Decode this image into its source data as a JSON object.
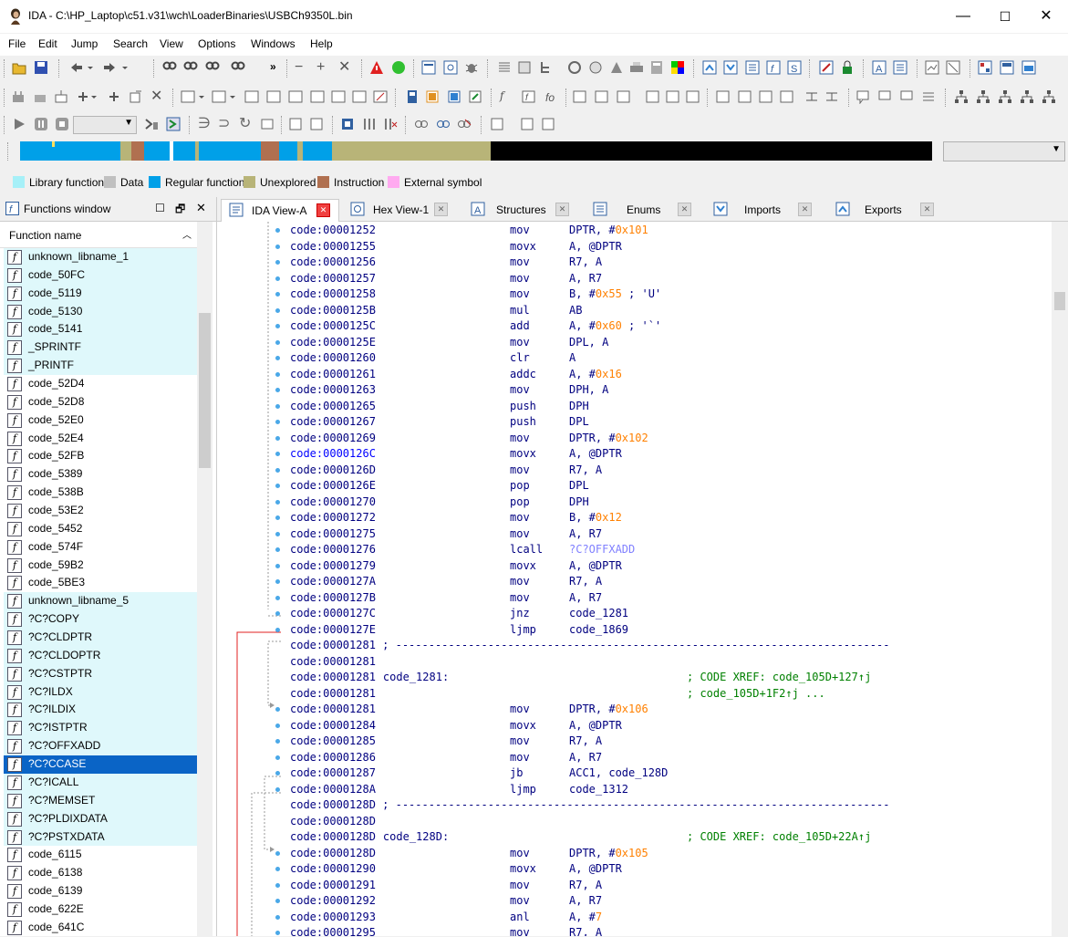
{
  "window": {
    "title": "IDA - C:\\HP_Laptop\\c51.v31\\wch\\LoaderBinaries\\USBCh9350L.bin",
    "min": "—",
    "max": "☐",
    "close": "✕"
  },
  "menu": [
    "File",
    "Edit",
    "Jump",
    "Search",
    "View",
    "Options",
    "Windows",
    "Help"
  ],
  "legend": [
    {
      "label": "Library function",
      "color": "#a6f0f8"
    },
    {
      "label": "Data",
      "color": "#c0c0c0"
    },
    {
      "label": "Regular function",
      "color": "#00a0e8"
    },
    {
      "label": "Unexplored",
      "color": "#b8b478"
    },
    {
      "label": "Instruction",
      "color": "#b07050"
    },
    {
      "label": "External symbol",
      "color": "#ffaaf0"
    }
  ],
  "functions_window": {
    "title": "Functions window",
    "column": "Function name",
    "items": [
      {
        "name": "unknown_libname_1",
        "lib": true
      },
      {
        "name": "code_50FC",
        "lib": true
      },
      {
        "name": "code_5119",
        "lib": true
      },
      {
        "name": "code_5130",
        "lib": true
      },
      {
        "name": "code_5141",
        "lib": true
      },
      {
        "name": "_SPRINTF",
        "lib": true
      },
      {
        "name": "_PRINTF",
        "lib": true
      },
      {
        "name": "code_52D4",
        "lib": false
      },
      {
        "name": "code_52D8",
        "lib": false
      },
      {
        "name": "code_52E0",
        "lib": false
      },
      {
        "name": "code_52E4",
        "lib": false
      },
      {
        "name": "code_52FB",
        "lib": false
      },
      {
        "name": "code_5389",
        "lib": false
      },
      {
        "name": "code_538B",
        "lib": false
      },
      {
        "name": "code_53E2",
        "lib": false
      },
      {
        "name": "code_5452",
        "lib": false
      },
      {
        "name": "code_574F",
        "lib": false
      },
      {
        "name": "code_59B2",
        "lib": false
      },
      {
        "name": "code_5BE3",
        "lib": false
      },
      {
        "name": "unknown_libname_5",
        "lib": true
      },
      {
        "name": "?C?COPY",
        "lib": true
      },
      {
        "name": "?C?CLDPTR",
        "lib": true
      },
      {
        "name": "?C?CLDOPTR",
        "lib": true
      },
      {
        "name": "?C?CSTPTR",
        "lib": true
      },
      {
        "name": "?C?ILDX",
        "lib": true
      },
      {
        "name": "?C?ILDIX",
        "lib": true
      },
      {
        "name": "?C?ISTPTR",
        "lib": true
      },
      {
        "name": "?C?OFFXADD",
        "lib": true
      },
      {
        "name": "?C?CCASE",
        "lib": true,
        "selected": true
      },
      {
        "name": "?C?ICALL",
        "lib": true
      },
      {
        "name": "?C?MEMSET",
        "lib": true
      },
      {
        "name": "?C?PLDIXDATA",
        "lib": true
      },
      {
        "name": "?C?PSTXDATA",
        "lib": true
      },
      {
        "name": "code_6115",
        "lib": false
      },
      {
        "name": "code_6138",
        "lib": false
      },
      {
        "name": "code_6139",
        "lib": false
      },
      {
        "name": "code_622E",
        "lib": false
      },
      {
        "name": "code_641C",
        "lib": false
      }
    ]
  },
  "tabs": [
    {
      "label": "IDA View-A",
      "active": true,
      "icon": "ida-view-icon"
    },
    {
      "label": "Hex View-1",
      "active": false,
      "icon": "hex-view-icon"
    },
    {
      "label": "Structures",
      "active": false,
      "icon": "structures-icon"
    },
    {
      "label": "Enums",
      "active": false,
      "icon": "enums-icon"
    },
    {
      "label": "Imports",
      "active": false,
      "icon": "imports-icon"
    },
    {
      "label": "Exports",
      "active": false,
      "icon": "exports-icon"
    }
  ],
  "disasm": [
    {
      "addr": "code:00001252",
      "label": "",
      "mn": "mov",
      "ops": [
        [
          "DPTR, #",
          ""
        ],
        [
          "0x101",
          "num"
        ]
      ],
      "cmt": ""
    },
    {
      "addr": "code:00001255",
      "label": "",
      "mn": "movx",
      "ops": [
        [
          "A, @DPTR",
          ""
        ]
      ],
      "cmt": ""
    },
    {
      "addr": "code:00001256",
      "label": "",
      "mn": "mov",
      "ops": [
        [
          "R7, A",
          ""
        ]
      ],
      "cmt": ""
    },
    {
      "addr": "code:00001257",
      "label": "",
      "mn": "mov",
      "ops": [
        [
          "A, R7",
          ""
        ]
      ],
      "cmt": ""
    },
    {
      "addr": "code:00001258",
      "label": "",
      "mn": "mov",
      "ops": [
        [
          "B, #",
          ""
        ],
        [
          "0x55",
          "num"
        ],
        [
          " ; 'U'",
          ""
        ]
      ],
      "cmt": ""
    },
    {
      "addr": "code:0000125B",
      "label": "",
      "mn": "mul",
      "ops": [
        [
          "AB",
          ""
        ]
      ],
      "cmt": ""
    },
    {
      "addr": "code:0000125C",
      "label": "",
      "mn": "add",
      "ops": [
        [
          "A, #",
          ""
        ],
        [
          "0x60",
          "num"
        ],
        [
          " ; '`'",
          ""
        ]
      ],
      "cmt": ""
    },
    {
      "addr": "code:0000125E",
      "label": "",
      "mn": "mov",
      "ops": [
        [
          "DPL, A",
          ""
        ]
      ],
      "cmt": ""
    },
    {
      "addr": "code:00001260",
      "label": "",
      "mn": "clr",
      "ops": [
        [
          "A",
          ""
        ]
      ],
      "cmt": ""
    },
    {
      "addr": "code:00001261",
      "label": "",
      "mn": "addc",
      "ops": [
        [
          "A, #",
          ""
        ],
        [
          "0x16",
          "num"
        ]
      ],
      "cmt": ""
    },
    {
      "addr": "code:00001263",
      "label": "",
      "mn": "mov",
      "ops": [
        [
          "DPH, A",
          ""
        ]
      ],
      "cmt": ""
    },
    {
      "addr": "code:00001265",
      "label": "",
      "mn": "push",
      "ops": [
        [
          "DPH",
          ""
        ]
      ],
      "cmt": ""
    },
    {
      "addr": "code:00001267",
      "label": "",
      "mn": "push",
      "ops": [
        [
          "DPL",
          ""
        ]
      ],
      "cmt": ""
    },
    {
      "addr": "code:00001269",
      "label": "",
      "mn": "mov",
      "ops": [
        [
          "DPTR, #",
          ""
        ],
        [
          "0x102",
          "num"
        ]
      ],
      "cmt": ""
    },
    {
      "addr": "code:0000126C",
      "label": "",
      "mn": "movx",
      "ops": [
        [
          "A, @DPTR",
          ""
        ]
      ],
      "cmt": "",
      "cur": true
    },
    {
      "addr": "code:0000126D",
      "label": "",
      "mn": "mov",
      "ops": [
        [
          "R7, A",
          ""
        ]
      ],
      "cmt": ""
    },
    {
      "addr": "code:0000126E",
      "label": "",
      "mn": "pop",
      "ops": [
        [
          "DPL",
          ""
        ]
      ],
      "cmt": ""
    },
    {
      "addr": "code:00001270",
      "label": "",
      "mn": "pop",
      "ops": [
        [
          "DPH",
          ""
        ]
      ],
      "cmt": ""
    },
    {
      "addr": "code:00001272",
      "label": "",
      "mn": "mov",
      "ops": [
        [
          "B, #",
          ""
        ],
        [
          "0x12",
          "num"
        ]
      ],
      "cmt": ""
    },
    {
      "addr": "code:00001275",
      "label": "",
      "mn": "mov",
      "ops": [
        [
          "A, R7",
          ""
        ]
      ],
      "cmt": ""
    },
    {
      "addr": "code:00001276",
      "label": "",
      "mn": "lcall",
      "ops": [
        [
          "?C?OFFXADD",
          "sym"
        ]
      ],
      "cmt": ""
    },
    {
      "addr": "code:00001279",
      "label": "",
      "mn": "movx",
      "ops": [
        [
          "A, @DPTR",
          ""
        ]
      ],
      "cmt": ""
    },
    {
      "addr": "code:0000127A",
      "label": "",
      "mn": "mov",
      "ops": [
        [
          "R7, A",
          ""
        ]
      ],
      "cmt": ""
    },
    {
      "addr": "code:0000127B",
      "label": "",
      "mn": "mov",
      "ops": [
        [
          "A, R7",
          ""
        ]
      ],
      "cmt": ""
    },
    {
      "addr": "code:0000127C",
      "label": "",
      "mn": "jnz",
      "ops": [
        [
          "code_1281",
          ""
        ]
      ],
      "cmt": ""
    },
    {
      "addr": "code:0000127E",
      "label": "",
      "mn": "ljmp",
      "ops": [
        [
          "code_1869",
          ""
        ]
      ],
      "cmt": ""
    },
    {
      "addr": "code:00001281",
      "sep": " ; ---------------------------------------------------------------------------"
    },
    {
      "addr": "code:00001281",
      "label": "",
      "mn": "",
      "ops": [],
      "cmt": ""
    },
    {
      "addr": "code:00001281",
      "label": "code_1281:",
      "mn": "",
      "ops": [],
      "cmt": "; CODE XREF: code_105D+127↑j"
    },
    {
      "addr": "code:00001281",
      "label": "",
      "mn": "",
      "ops": [],
      "cmt": "; code_105D+1F2↑j ..."
    },
    {
      "addr": "code:00001281",
      "label": "",
      "mn": "mov",
      "ops": [
        [
          "DPTR, #",
          ""
        ],
        [
          "0x106",
          "num"
        ]
      ],
      "cmt": ""
    },
    {
      "addr": "code:00001284",
      "label": "",
      "mn": "movx",
      "ops": [
        [
          "A, @DPTR",
          ""
        ]
      ],
      "cmt": ""
    },
    {
      "addr": "code:00001285",
      "label": "",
      "mn": "mov",
      "ops": [
        [
          "R7, A",
          ""
        ]
      ],
      "cmt": ""
    },
    {
      "addr": "code:00001286",
      "label": "",
      "mn": "mov",
      "ops": [
        [
          "A, R7",
          ""
        ]
      ],
      "cmt": ""
    },
    {
      "addr": "code:00001287",
      "label": "",
      "mn": "jb",
      "ops": [
        [
          "ACC1, code_128D",
          ""
        ]
      ],
      "cmt": ""
    },
    {
      "addr": "code:0000128A",
      "label": "",
      "mn": "ljmp",
      "ops": [
        [
          "code_1312",
          ""
        ]
      ],
      "cmt": ""
    },
    {
      "addr": "code:0000128D",
      "sep": " ; ---------------------------------------------------------------------------"
    },
    {
      "addr": "code:0000128D",
      "label": "",
      "mn": "",
      "ops": [],
      "cmt": ""
    },
    {
      "addr": "code:0000128D",
      "label": "code_128D:",
      "mn": "",
      "ops": [],
      "cmt": "; CODE XREF: code_105D+22A↑j"
    },
    {
      "addr": "code:0000128D",
      "label": "",
      "mn": "mov",
      "ops": [
        [
          "DPTR, #",
          ""
        ],
        [
          "0x105",
          "num"
        ]
      ],
      "cmt": ""
    },
    {
      "addr": "code:00001290",
      "label": "",
      "mn": "movx",
      "ops": [
        [
          "A, @DPTR",
          ""
        ]
      ],
      "cmt": ""
    },
    {
      "addr": "code:00001291",
      "label": "",
      "mn": "mov",
      "ops": [
        [
          "R7, A",
          ""
        ]
      ],
      "cmt": ""
    },
    {
      "addr": "code:00001292",
      "label": "",
      "mn": "mov",
      "ops": [
        [
          "A, R7",
          ""
        ]
      ],
      "cmt": ""
    },
    {
      "addr": "code:00001293",
      "label": "",
      "mn": "anl",
      "ops": [
        [
          "A, #",
          ""
        ],
        [
          "7",
          "num"
        ]
      ],
      "cmt": ""
    },
    {
      "addr": "code:00001295",
      "label": "",
      "mn": "mov",
      "ops": [
        [
          "R7, A",
          ""
        ]
      ],
      "cmt": ""
    }
  ]
}
